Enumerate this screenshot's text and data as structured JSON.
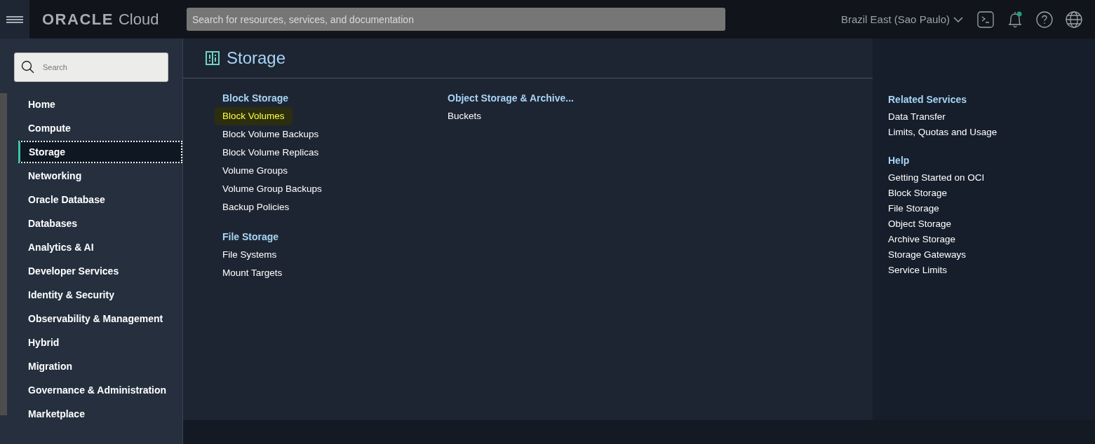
{
  "header": {
    "logo": {
      "brand": "ORACLE",
      "product": "Cloud"
    },
    "search": {
      "placeholder": "Search for resources, services, and documentation"
    },
    "region": "Brazil East (Sao Paulo)",
    "notifications": {
      "unread": true
    }
  },
  "sidebar": {
    "search": {
      "placeholder": "Search"
    },
    "items": [
      {
        "label": "Home",
        "selected": false
      },
      {
        "label": "Compute",
        "selected": false
      },
      {
        "label": "Storage",
        "selected": true
      },
      {
        "label": "Networking",
        "selected": false
      },
      {
        "label": "Oracle Database",
        "selected": false
      },
      {
        "label": "Databases",
        "selected": false
      },
      {
        "label": "Analytics & AI",
        "selected": false
      },
      {
        "label": "Developer Services",
        "selected": false
      },
      {
        "label": "Identity & Security",
        "selected": false
      },
      {
        "label": "Observability & Management",
        "selected": false
      },
      {
        "label": "Hybrid",
        "selected": false
      },
      {
        "label": "Migration",
        "selected": false
      },
      {
        "label": "Governance & Administration",
        "selected": false
      },
      {
        "label": "Marketplace",
        "selected": false
      }
    ]
  },
  "page": {
    "title": "Storage",
    "columns": [
      [
        {
          "heading": "Block Storage",
          "links": [
            {
              "label": "Block Volumes",
              "highlighted": true
            },
            {
              "label": "Block Volume Backups",
              "highlighted": false
            },
            {
              "label": "Block Volume Replicas",
              "highlighted": false
            },
            {
              "label": "Volume Groups",
              "highlighted": false
            },
            {
              "label": "Volume Group Backups",
              "highlighted": false
            },
            {
              "label": "Backup Policies",
              "highlighted": false
            }
          ]
        },
        {
          "heading": "File Storage",
          "links": [
            {
              "label": "File Systems",
              "highlighted": false
            },
            {
              "label": "Mount Targets",
              "highlighted": false
            }
          ]
        }
      ],
      [
        {
          "heading": "Object Storage & Archive...",
          "links": [
            {
              "label": "Buckets",
              "highlighted": false
            }
          ]
        }
      ]
    ]
  },
  "related": [
    {
      "heading": "Related Services",
      "links": [
        "Data Transfer",
        "Limits, Quotas and Usage"
      ]
    },
    {
      "heading": "Help",
      "links": [
        "Getting Started on OCI",
        "Block Storage",
        "File Storage",
        "Object Storage",
        "Archive Storage",
        "Storage Gateways",
        "Service Limits"
      ]
    }
  ]
}
